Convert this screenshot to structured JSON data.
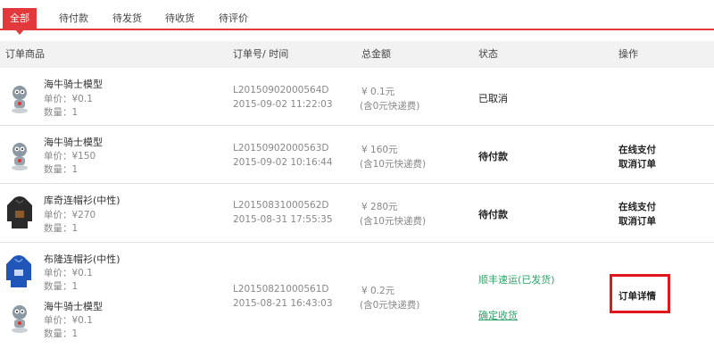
{
  "tabs": [
    "全部",
    "待付款",
    "待发货",
    "待收货",
    "待评价"
  ],
  "header": {
    "product": "订单商品",
    "order": "订单号/ 时间",
    "total": "总金额",
    "status": "状态",
    "action": "操作"
  },
  "orders": [
    {
      "items": [
        {
          "name": "海牛骑士模型",
          "price": "单价：¥0.1",
          "qty": "数量：1",
          "thumb": "robot-figure-thumbnail"
        }
      ],
      "order_no": "L20150902000564D",
      "time": "2015-09-02 11:22:03",
      "amount": "¥ 0.1元",
      "shipping": "(含0元快递费)",
      "status": "已取消",
      "actions": []
    },
    {
      "items": [
        {
          "name": "海牛骑士模型",
          "price": "单价：¥150",
          "qty": "数量：1",
          "thumb": "robot-figure-thumbnail"
        }
      ],
      "order_no": "L20150902000563D",
      "time": "2015-09-02 10:16:44",
      "amount": "¥ 160元",
      "shipping": "(含10元快递费)",
      "status": "待付款",
      "actions": [
        "在线支付",
        "取消订单"
      ]
    },
    {
      "items": [
        {
          "name": "库奇连帽衫(中性)",
          "price": "单价：¥270",
          "qty": "数量：1",
          "thumb": "black-hoodie-thumbnail"
        }
      ],
      "order_no": "L20150831000562D",
      "time": "2015-08-31 17:55:35",
      "amount": "¥ 280元",
      "shipping": "(含10元快递费)",
      "status": "待付款",
      "actions": [
        "在线支付",
        "取消订单"
      ]
    },
    {
      "items": [
        {
          "name": "布隆连帽衫(中性)",
          "price": "单价：¥0.1",
          "qty": "数量：1",
          "thumb": "blue-hoodie-thumbnail"
        },
        {
          "name": "海牛骑士模型",
          "price": "单价：¥0.1",
          "qty": "数量：1",
          "thumb": "robot-figure-thumbnail"
        }
      ],
      "order_no": "L20150821000561D",
      "time": "2015-08-21 16:43:03",
      "amount": "¥ 0.2元",
      "shipping": "(含0元快递费)",
      "status": "顺丰速运(已发货)",
      "confirm": "确定收货",
      "actions": [
        "订单详情"
      ]
    }
  ],
  "colors": {
    "accent": "#e4393c",
    "green": "#2ea66a",
    "highlight_border": "#e4161b"
  }
}
